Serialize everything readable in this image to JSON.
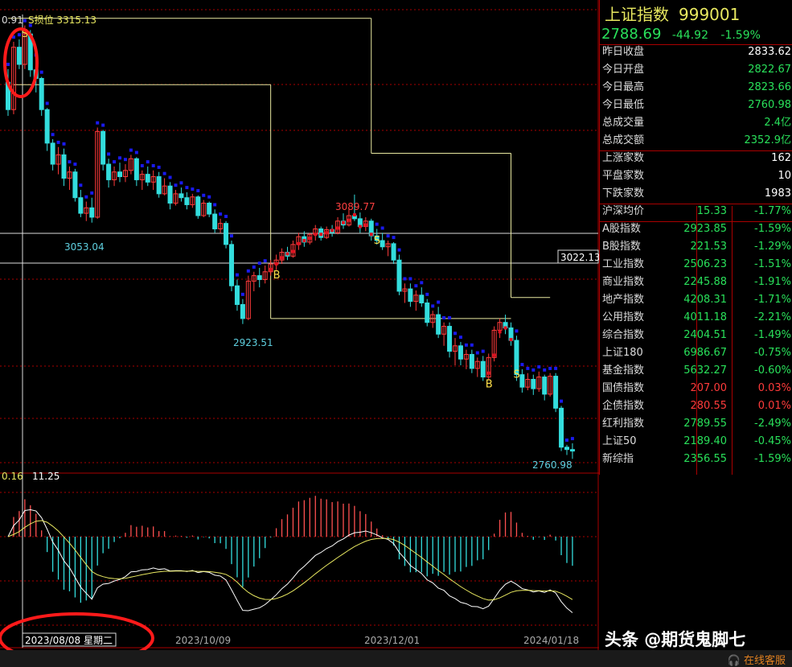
{
  "panel": {
    "name": "上证指数",
    "code": "999001",
    "price": "2788.69",
    "change": "-44.92",
    "pct": "-1.59%",
    "stats": [
      {
        "label": "昨日收盘",
        "value": "2833.62",
        "color": "white"
      },
      {
        "label": "今日开盘",
        "value": "2822.67",
        "color": "green"
      },
      {
        "label": "今日最高",
        "value": "2823.66",
        "color": "green"
      },
      {
        "label": "今日最低",
        "value": "2760.98",
        "color": "green"
      },
      {
        "label": "总成交量",
        "value": "2.4亿",
        "color": "green"
      },
      {
        "label": "总成交额",
        "value": "2352.9亿",
        "color": "green"
      }
    ],
    "breadth": [
      {
        "label": "上涨家数",
        "value": "162",
        "color": "white"
      },
      {
        "label": "平盘家数",
        "value": "10",
        "color": "white"
      },
      {
        "label": "下跌家数",
        "value": "1983",
        "color": "white"
      }
    ],
    "avg": {
      "label": "沪深均价",
      "value": "15.33",
      "pct": "-1.77%"
    },
    "indices": [
      {
        "label": "A股指数",
        "value": "2923.85",
        "pct": "-1.59%",
        "color": "green"
      },
      {
        "label": "B股指数",
        "value": "221.53",
        "pct": "-1.29%",
        "color": "green"
      },
      {
        "label": "工业指数",
        "value": "2506.23",
        "pct": "-1.51%",
        "color": "green"
      },
      {
        "label": "商业指数",
        "value": "2245.88",
        "pct": "-1.91%",
        "color": "green"
      },
      {
        "label": "地产指数",
        "value": "4208.31",
        "pct": "-1.71%",
        "color": "green"
      },
      {
        "label": "公用指数",
        "value": "4011.18",
        "pct": "-2.21%",
        "color": "green"
      },
      {
        "label": "综合指数",
        "value": "2404.51",
        "pct": "-1.49%",
        "color": "green"
      },
      {
        "label": "上证180",
        "value": "6986.67",
        "pct": "-0.75%",
        "color": "green"
      },
      {
        "label": "基金指数",
        "value": "5632.27",
        "pct": "-0.60%",
        "color": "green"
      },
      {
        "label": "国债指数",
        "value": "207.00",
        "pct": "0.03%",
        "color": "red"
      },
      {
        "label": "企债指数",
        "value": "280.55",
        "pct": "0.01%",
        "color": "red"
      },
      {
        "label": "红利指数",
        "value": "2789.55",
        "pct": "-2.49%",
        "color": "green"
      },
      {
        "label": "上证50",
        "value": "2189.40",
        "pct": "-0.45%",
        "color": "green"
      },
      {
        "label": "新综指",
        "value": "2356.55",
        "pct": "-1.59%",
        "color": "green"
      }
    ]
  },
  "chart_data": {
    "type": "candlestick",
    "header_left": "0.91",
    "header_label": "S损位 3315.13",
    "y_axis_labels": [
      "3022.13"
    ],
    "annotations": [
      {
        "text": "3053.04",
        "kind": "low"
      },
      {
        "text": "2923.51",
        "kind": "low"
      },
      {
        "text": "3089.77",
        "kind": "high"
      },
      {
        "text": "2760.98",
        "kind": "low"
      }
    ],
    "signals": [
      {
        "text": "S",
        "index": 3
      },
      {
        "text": "B",
        "index": 48
      },
      {
        "text": "S",
        "index": 66
      },
      {
        "text": "B",
        "index": 86
      },
      {
        "text": "S",
        "index": 91
      }
    ],
    "x_tick_labels": [
      "2023/10/09",
      "2023/12/01",
      "2024/01/18"
    ],
    "cursor_label": "2023/08/08 星期二",
    "macd_labels": [
      "0.16",
      "11.25"
    ],
    "price_range": [
      2740,
      3320
    ],
    "stop_levels": [
      {
        "from": 0,
        "to": 65,
        "value": 3315.13
      },
      {
        "from": 1,
        "to": 47,
        "value": 3230
      },
      {
        "from": 47,
        "to": 90,
        "value": 2930
      },
      {
        "from": 65,
        "to": 90,
        "value": 3142
      },
      {
        "from": 90,
        "to": 97,
        "value": 2957
      }
    ],
    "candles": [
      [
        3233,
        3250,
        3190,
        3198
      ],
      [
        3198,
        3285,
        3192,
        3278
      ],
      [
        3278,
        3288,
        3250,
        3256
      ],
      [
        3256,
        3306,
        3250,
        3295
      ],
      [
        3295,
        3300,
        3240,
        3249
      ],
      [
        3249,
        3262,
        3220,
        3238
      ],
      [
        3238,
        3240,
        3190,
        3198
      ],
      [
        3198,
        3200,
        3145,
        3155
      ],
      [
        3155,
        3160,
        3120,
        3128
      ],
      [
        3128,
        3150,
        3115,
        3140
      ],
      [
        3140,
        3148,
        3100,
        3110
      ],
      [
        3110,
        3125,
        3095,
        3118
      ],
      [
        3118,
        3122,
        3080,
        3085
      ],
      [
        3085,
        3095,
        3060,
        3065
      ],
      [
        3065,
        3080,
        3055,
        3072
      ],
      [
        3072,
        3085,
        3053,
        3060
      ],
      [
        3060,
        3175,
        3058,
        3170
      ],
      [
        3170,
        3172,
        3120,
        3128
      ],
      [
        3128,
        3135,
        3098,
        3108
      ],
      [
        3108,
        3125,
        3100,
        3118
      ],
      [
        3118,
        3130,
        3105,
        3112
      ],
      [
        3112,
        3128,
        3105,
        3120
      ],
      [
        3120,
        3140,
        3115,
        3135
      ],
      [
        3135,
        3137,
        3100,
        3108
      ],
      [
        3108,
        3120,
        3095,
        3115
      ],
      [
        3115,
        3125,
        3100,
        3105
      ],
      [
        3105,
        3120,
        3095,
        3112
      ],
      [
        3112,
        3118,
        3085,
        3090
      ],
      [
        3090,
        3110,
        3088,
        3100
      ],
      [
        3100,
        3105,
        3070,
        3078
      ],
      [
        3078,
        3095,
        3075,
        3090
      ],
      [
        3090,
        3098,
        3080,
        3085
      ],
      [
        3085,
        3092,
        3070,
        3076
      ],
      [
        3076,
        3090,
        3072,
        3086
      ],
      [
        3086,
        3088,
        3058,
        3062
      ],
      [
        3062,
        3082,
        3060,
        3078
      ],
      [
        3078,
        3080,
        3060,
        3064
      ],
      [
        3064,
        3070,
        3040,
        3045
      ],
      [
        3045,
        3058,
        3040,
        3052
      ],
      [
        3052,
        3055,
        3020,
        3025
      ],
      [
        3025,
        3030,
        2965,
        2972
      ],
      [
        2972,
        2980,
        2940,
        2948
      ],
      [
        2948,
        2955,
        2923,
        2930
      ],
      [
        2930,
        2985,
        2928,
        2978
      ],
      [
        2978,
        2990,
        2965,
        2985
      ],
      [
        2985,
        2995,
        2970,
        2980
      ],
      [
        2980,
        2998,
        2975,
        2990
      ],
      [
        2990,
        3005,
        2985,
        3000
      ],
      [
        3000,
        3012,
        2992,
        3005
      ],
      [
        3005,
        3020,
        3000,
        3015
      ],
      [
        3015,
        3022,
        3005,
        3010
      ],
      [
        3010,
        3030,
        3008,
        3025
      ],
      [
        3025,
        3040,
        3018,
        3035
      ],
      [
        3035,
        3042,
        3022,
        3028
      ],
      [
        3028,
        3040,
        3025,
        3038
      ],
      [
        3038,
        3050,
        3030,
        3045
      ],
      [
        3045,
        3048,
        3030,
        3034
      ],
      [
        3034,
        3048,
        3032,
        3044
      ],
      [
        3044,
        3050,
        3035,
        3040
      ],
      [
        3040,
        3060,
        3038,
        3055
      ],
      [
        3055,
        3065,
        3045,
        3050
      ],
      [
        3050,
        3070,
        3048,
        3062
      ],
      [
        3062,
        3089,
        3055,
        3058
      ],
      [
        3058,
        3066,
        3040,
        3048
      ],
      [
        3048,
        3060,
        3042,
        3055
      ],
      [
        3055,
        3058,
        3030,
        3036
      ],
      [
        3036,
        3045,
        3025,
        3030
      ],
      [
        3030,
        3040,
        3018,
        3022
      ],
      [
        3022,
        3030,
        3010,
        3026
      ],
      [
        3026,
        3028,
        3000,
        3005
      ],
      [
        3005,
        3012,
        2960,
        2965
      ],
      [
        2965,
        2975,
        2950,
        2968
      ],
      [
        2968,
        2975,
        2945,
        2952
      ],
      [
        2952,
        2966,
        2940,
        2960
      ],
      [
        2960,
        2970,
        2945,
        2950
      ],
      [
        2950,
        2955,
        2920,
        2925
      ],
      [
        2925,
        2940,
        2918,
        2935
      ],
      [
        2935,
        2945,
        2905,
        2910
      ],
      [
        2910,
        2925,
        2895,
        2920
      ],
      [
        2920,
        2925,
        2880,
        2888
      ],
      [
        2888,
        2905,
        2870,
        2895
      ],
      [
        2895,
        2900,
        2870,
        2878
      ],
      [
        2878,
        2890,
        2865,
        2884
      ],
      [
        2884,
        2890,
        2860,
        2866
      ],
      [
        2866,
        2880,
        2855,
        2875
      ],
      [
        2875,
        2882,
        2850,
        2855
      ],
      [
        2855,
        2885,
        2852,
        2880
      ],
      [
        2880,
        2920,
        2875,
        2915
      ],
      [
        2915,
        2930,
        2905,
        2925
      ],
      [
        2925,
        2935,
        2910,
        2918
      ],
      [
        2918,
        2925,
        2895,
        2902
      ],
      [
        2902,
        2908,
        2850,
        2858
      ],
      [
        2858,
        2865,
        2835,
        2842
      ],
      [
        2842,
        2860,
        2838,
        2852
      ],
      [
        2852,
        2858,
        2832,
        2840
      ],
      [
        2840,
        2862,
        2836,
        2855
      ],
      [
        2855,
        2858,
        2825,
        2833
      ],
      [
        2833,
        2860,
        2830,
        2856
      ],
      [
        2856,
        2860,
        2810,
        2815
      ],
      [
        2815,
        2818,
        2760,
        2765
      ],
      [
        2765,
        2768,
        2755,
        2762
      ],
      [
        2762,
        2770,
        2750,
        2760
      ]
    ]
  }
}
